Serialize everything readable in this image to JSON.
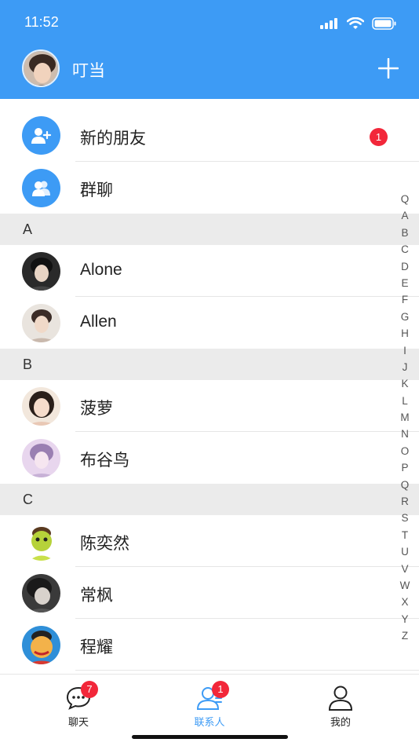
{
  "status_bar": {
    "time": "11:52"
  },
  "header": {
    "title": "叮当"
  },
  "top_items": [
    {
      "label": "新的朋友",
      "badge": "1"
    },
    {
      "label": "群聊"
    }
  ],
  "sections": [
    {
      "letter": "A",
      "contacts": [
        {
          "name": "Alone"
        },
        {
          "name": "Allen"
        }
      ]
    },
    {
      "letter": "B",
      "contacts": [
        {
          "name": "菠萝"
        },
        {
          "name": "布谷鸟"
        }
      ]
    },
    {
      "letter": "C",
      "contacts": [
        {
          "name": "陈奕然"
        },
        {
          "name": "常枫"
        },
        {
          "name": "程耀"
        }
      ]
    }
  ],
  "index_letters": [
    "Q",
    "A",
    "B",
    "C",
    "D",
    "E",
    "F",
    "G",
    "H",
    "I",
    "J",
    "K",
    "L",
    "M",
    "N",
    "O",
    "P",
    "Q",
    "R",
    "S",
    "T",
    "U",
    "V",
    "W",
    "X",
    "Y",
    "Z"
  ],
  "tabs": [
    {
      "label": "聊天",
      "badge": "7"
    },
    {
      "label": "联系人",
      "badge": "1"
    },
    {
      "label": "我的"
    }
  ],
  "colors": {
    "accent": "#3d9bf5",
    "badge": "#f2273a"
  }
}
